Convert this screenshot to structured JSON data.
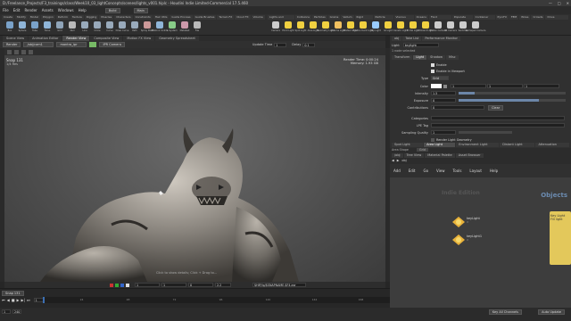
{
  "titlebar": {
    "title": "D:/Freelance_Projects/F3_trainings/class/Week10_03_lightConcepts/scenes/lights_v001.hiplc - Houdini Indie Limited-Commercial 17.5.460",
    "min": "—",
    "max": "□",
    "close": "✕"
  },
  "menubar": {
    "items": [
      "File",
      "Edit",
      "Render",
      "Assets",
      "Windows",
      "Help"
    ],
    "build_label": "Build",
    "desktop_label": "Main"
  },
  "shelf": {
    "tabs": [
      "Create",
      "Modify",
      "Model",
      "Polygon",
      "Deform",
      "Texture",
      "Rigging",
      "Muscles",
      "Characters",
      "Constraints",
      "Hair Utils",
      "Guide Process",
      "Guide Brushes",
      "Terrain FX",
      "Cloud FX",
      "Volume"
    ],
    "light_tabs": [
      "Lights and Cameras",
      "Collisions",
      "Particles",
      "Grains",
      "Vellum",
      "Rigid Bodies",
      "Particle Fluids",
      "Viscous Fluids",
      "Oceans",
      "Fluid Containers",
      "Populate Con..",
      "Container Tools",
      "PyroFX",
      "FEM",
      "Wires",
      "Crowds",
      "Drive Simulation"
    ],
    "tools": [
      {
        "label": "Box",
        "icon": "box-icon",
        "color": "#7aa2c9"
      },
      {
        "label": "Sphere",
        "icon": "sphere-icon",
        "color": "#8fb5d8"
      },
      {
        "label": "Tube",
        "icon": "tube-icon",
        "color": "#7aa2c9"
      },
      {
        "label": "Torus",
        "icon": "torus-icon",
        "color": "#8fb5d8"
      },
      {
        "label": "Grid",
        "icon": "grid-icon",
        "color": "#8fa4b8"
      },
      {
        "label": "Null",
        "icon": "null-icon",
        "color": "#bbbbbb"
      },
      {
        "label": "Line",
        "icon": "line-icon",
        "color": "#9ab"
      },
      {
        "label": "Circle",
        "icon": "circle-icon",
        "color": "#9ab"
      },
      {
        "label": "Curve",
        "icon": "curve-icon",
        "color": "#9ab"
      },
      {
        "label": "Draw Curve",
        "icon": "draw-curve-icon",
        "color": "#9ab"
      },
      {
        "label": "Path",
        "icon": "path-icon",
        "color": "#9ab"
      },
      {
        "label": "Spray Paint",
        "icon": "spray-paint-icon",
        "color": "#c99"
      },
      {
        "label": "Platonic Solids",
        "icon": "platonic-icon",
        "color": "#8fb5d8"
      },
      {
        "label": "L-System",
        "icon": "lsystem-icon",
        "color": "#8c8"
      },
      {
        "label": "Metaball",
        "icon": "metaball-icon",
        "color": "#c9a"
      },
      {
        "label": "File",
        "icon": "file-icon",
        "color": "#bbb"
      }
    ],
    "light_tools": [
      {
        "label": "Camera",
        "icon": "camera-icon",
        "color": "#ccc"
      },
      {
        "label": "Point Light",
        "icon": "point-light-icon",
        "color": "#f0d040"
      },
      {
        "label": "Spot Light",
        "icon": "spot-light-icon",
        "color": "#f0d040"
      },
      {
        "label": "Area Light",
        "icon": "area-light-icon",
        "color": "#f0d040"
      },
      {
        "label": "Geometry Light",
        "icon": "geometry-light-icon",
        "color": "#f0d040"
      },
      {
        "label": "Volume Light",
        "icon": "volume-light-icon",
        "color": "#f0c060"
      },
      {
        "label": "Distant Light",
        "icon": "distant-light-icon",
        "color": "#f0d040"
      },
      {
        "label": "Environment Light",
        "icon": "environment-light-icon",
        "color": "#f0d040"
      },
      {
        "label": "Sky Light",
        "icon": "sky-light-icon",
        "color": "#9cf"
      },
      {
        "label": "GI Light",
        "icon": "gi-light-icon",
        "color": "#f0d040"
      },
      {
        "label": "Caustic Light",
        "icon": "caustic-light-icon",
        "color": "#f0d040"
      },
      {
        "label": "Portal Light",
        "icon": "portal-light-icon",
        "color": "#f0d040"
      },
      {
        "label": "Ambient Light",
        "icon": "ambient-light-icon",
        "color": "#f0d040"
      },
      {
        "label": "Stereo Camera",
        "icon": "stereo-camera-icon",
        "color": "#ccc"
      },
      {
        "label": "VR Camera",
        "icon": "vr-camera-icon",
        "color": "#ccc"
      },
      {
        "label": "Switcher",
        "icon": "switcher-icon",
        "color": "#ccc"
      },
      {
        "label": "Gamepad Camera",
        "icon": "gamepad-camera-icon",
        "color": "#ccc"
      }
    ]
  },
  "viewport": {
    "tabs": [
      "Scene View",
      "Animation Editor",
      "Render View",
      "Composite View",
      "Motion FX View",
      "Geometry Spreadsheet"
    ],
    "active_tab": "Render View",
    "toolbar": {
      "render_label": "Render",
      "camera_label": "/obj/cam1",
      "renderer_label": "mantra_ipr",
      "snapshot_label": "IPR Camera",
      "update_label": "Update Time",
      "update_value": "1",
      "delay_label": "Delay",
      "delay_value": "0.1"
    },
    "snap_label": "Snap 131",
    "snap_sub": "1/4 Res",
    "render_time_label": "Render Time: ",
    "render_time_value": "0:00:24",
    "memory_label": "Memory: ",
    "memory_value": "1.93 GB",
    "bottom_hint": "Click to show details; Click + Drag to...",
    "path": "$HIP/ip/$SNAPNAME.$F4.exr",
    "zoom_value": "2.2",
    "frame_a": "1",
    "frame_b": "1",
    "frame_c": "0",
    "snap_bottom": "Snap 131"
  },
  "timeline": {
    "frame_start": "1",
    "frame_end": "240",
    "current_frame": "1",
    "range_start": "1",
    "range_end": "240",
    "ticks": [
      "24",
      "48",
      "72",
      "96",
      "120",
      "144",
      "168",
      "192",
      "216",
      "240"
    ],
    "keys_label": "Keys: 0/0 Selected",
    "channels_label": "Key All Channels",
    "auto_update": "Auto Update"
  },
  "params": {
    "tabs": [
      "obj",
      "Take List",
      "Performance Monitor"
    ],
    "node_type": "Light",
    "node_name": "keylight",
    "selected_note": "1 node selected",
    "sub_tabs": [
      "Transform",
      "Light",
      "Shadow",
      "Misc"
    ],
    "active_sub_tab": "Light",
    "enable_label": "Enable",
    "enable_viewport_label": "Enable in Viewport",
    "type_label": "Type",
    "type_value": "Grid",
    "color_label": "Color",
    "color_values": [
      "1",
      "1",
      "1"
    ],
    "intensity_label": "Intensity",
    "intensity_value": "1.5",
    "intensity_fraction": 0.15,
    "exposure_label": "Exposure",
    "exposure_value": "0",
    "exposure_fraction": 0.75,
    "contribution_label": "Contributions",
    "contribution_value": "0",
    "contribution_btn": "Clear",
    "categories_label": "Categories",
    "lpe_label": "LPE Tag",
    "sampling_label": "Sampling Quality",
    "sampling_value": "1",
    "render_geo_label": "Render Light Geometry",
    "area_tabs": [
      "Spot Light Options",
      "Area Light Options",
      "Environment Light Options",
      "Distant Light Options",
      "Attenuation Options"
    ],
    "active_area_tab": "Area Light Options",
    "area_shape_label": "Area Shape",
    "area_shape_value": "Grid"
  },
  "network": {
    "tabs": [
      "/obj",
      "Tree View",
      "Material Palette",
      "Asset Browser"
    ],
    "path": "obj",
    "menu": [
      "Add",
      "Edit",
      "Go",
      "View",
      "Tools",
      "Layout",
      "Help"
    ],
    "context_label": "Indie Edition",
    "objects_label": "Objects",
    "nodes": [
      {
        "label": "keyLight",
        "sub": "rl"
      },
      {
        "label": "keyLight1",
        "sub": "rl"
      }
    ],
    "side_labels": [
      "Key Light",
      "Fill light"
    ]
  }
}
